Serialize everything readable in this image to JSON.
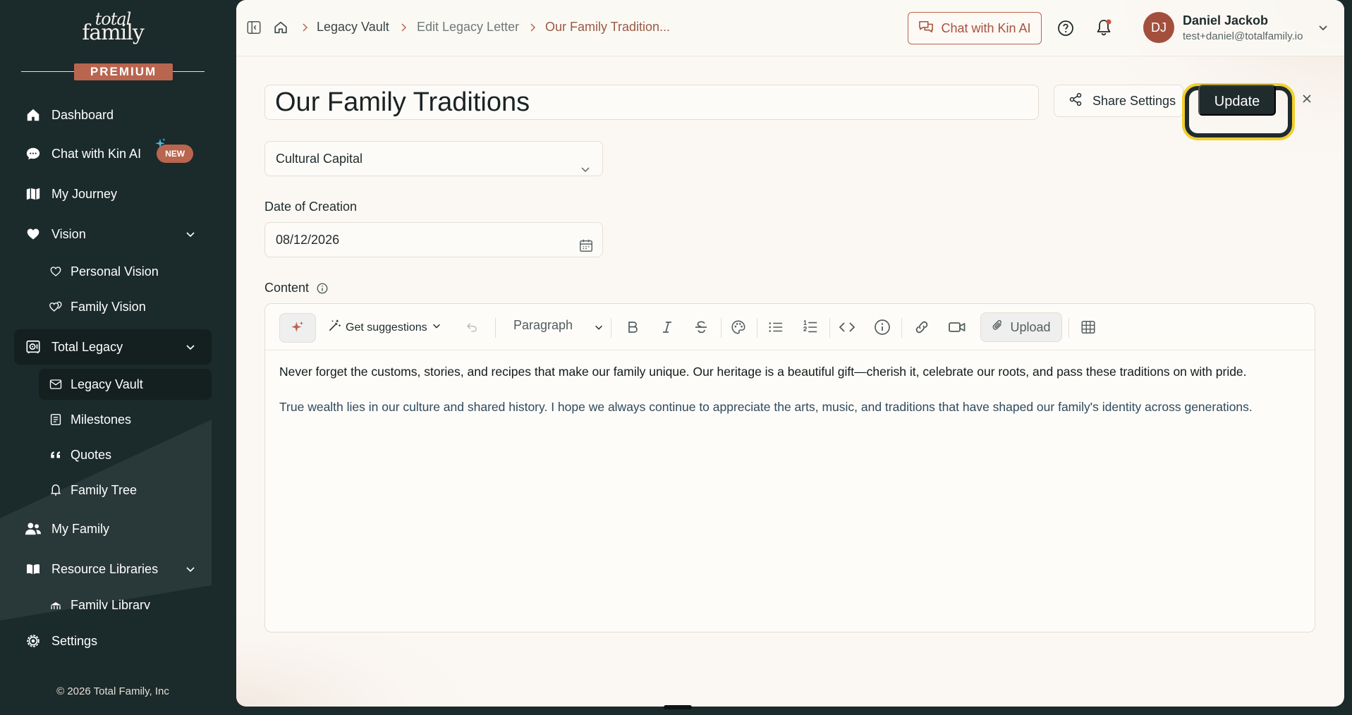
{
  "brand": {
    "logo_line1": "total",
    "logo_line2": "family",
    "tier_badge": "PREMIUM"
  },
  "sidebar": {
    "items": [
      {
        "label": "Dashboard",
        "icon": "home-icon"
      },
      {
        "label": "Chat with Kin AI",
        "icon": "chat-bubble-icon",
        "badge": "NEW"
      },
      {
        "label": "My Journey",
        "icon": "map-icon"
      },
      {
        "label": "Vision",
        "icon": "heart-icon",
        "expandable": true
      },
      {
        "label": "Personal Vision",
        "icon": "heart-outline-icon"
      },
      {
        "label": "Family Vision",
        "icon": "hearts-icon"
      },
      {
        "label": "Total Legacy",
        "icon": "vault-icon",
        "expandable": true,
        "active": true
      },
      {
        "label": "Legacy Vault",
        "icon": "envelope-icon",
        "active": true
      },
      {
        "label": "Milestones",
        "icon": "journal-icon"
      },
      {
        "label": "Quotes",
        "icon": "quote-icon"
      },
      {
        "label": "Family Tree",
        "icon": "tree-icon"
      },
      {
        "label": "My Family",
        "icon": "people-icon"
      },
      {
        "label": "Resource Libraries",
        "icon": "book-icon",
        "expandable": true
      },
      {
        "label": "Family Library",
        "icon": "library-icon"
      },
      {
        "label": "Settings",
        "icon": "gear-icon"
      }
    ],
    "copyright": "© 2026 Total Family, Inc"
  },
  "header": {
    "breadcrumbs": [
      "Legacy Vault",
      "Edit Legacy Letter",
      "Our Family Tradition..."
    ],
    "chat_button": "Chat with Kin AI",
    "user": {
      "initials": "DJ",
      "name": "Daniel Jackob",
      "email": "test+daniel@totalfamily.io"
    }
  },
  "editor_form": {
    "title": "Our Family Traditions",
    "share_button": "Share Settings",
    "update_button": "Update",
    "category": "Cultural Capital",
    "date_label": "Date of Creation",
    "date_value": "08/12/2026",
    "content_label": "Content",
    "toolbar": {
      "suggestions": "Get suggestions",
      "block_style": "Paragraph",
      "upload": "Upload"
    },
    "paragraphs": [
      "Never forget the customs, stories, and recipes that make our family unique. Our heritage is a beautiful gift—cherish it, celebrate our roots, and pass these traditions on with pride.",
      "True wealth lies in our culture and shared history. I hope we always continue to appreciate the arts, music, and traditions that have shaped our family's identity across generations."
    ]
  },
  "colors": {
    "sidebar_bg": "#1b2a2b",
    "accent": "#b9654f",
    "highlight_ring": "#f2cf2c",
    "primary_button": "#1f2b2c"
  }
}
